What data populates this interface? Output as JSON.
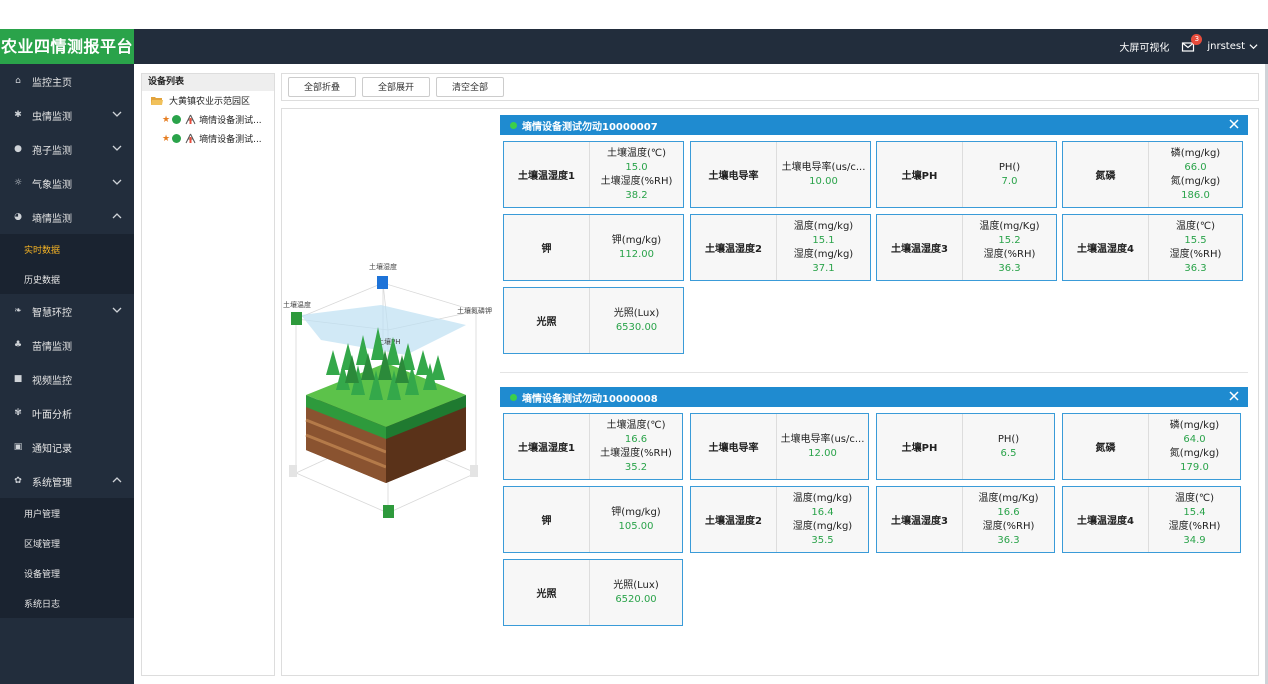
{
  "app": {
    "title": "农业四情测报平台"
  },
  "header": {
    "bigscreen": "大屏可视化",
    "notify_count": "3",
    "user": "jnrstest"
  },
  "sidebar": {
    "items": [
      {
        "label": "监控主页",
        "icon": "home-icon"
      },
      {
        "label": "虫情监测",
        "icon": "bug-icon"
      },
      {
        "label": "孢子监测",
        "icon": "spore-icon"
      },
      {
        "label": "气象监测",
        "icon": "sun-icon"
      },
      {
        "label": "墒情监测",
        "icon": "soil-icon"
      },
      {
        "label": "实时数据"
      },
      {
        "label": "历史数据"
      },
      {
        "label": "智慧环控",
        "icon": "leaf-icon"
      },
      {
        "label": "苗情监测",
        "icon": "seedling-icon"
      },
      {
        "label": "视频监控",
        "icon": "video-icon"
      },
      {
        "label": "叶面分析",
        "icon": "plant-icon"
      },
      {
        "label": "通知记录",
        "icon": "message-icon"
      },
      {
        "label": "系统管理",
        "icon": "gear-icon"
      },
      {
        "label": "用户管理"
      },
      {
        "label": "区域管理"
      },
      {
        "label": "设备管理"
      },
      {
        "label": "系统日志"
      }
    ]
  },
  "tree": {
    "header": "设备列表",
    "root": "大黄镇农业示范园区",
    "devices": [
      "墒情设备测试...",
      "墒情设备测试..."
    ]
  },
  "toolbar": {
    "collapse_all": "全部折叠",
    "expand_all": "全部展开",
    "clear_all": "清空全部"
  },
  "iso_labels": {
    "top": "土壤湿度",
    "left": "土壤温度",
    "right": "土壤氮磷钾",
    "mid": "土壤PH"
  },
  "devices": [
    {
      "title": "墒情设备测试勿动10000007",
      "cards": [
        {
          "name": "土壤温湿度1",
          "lines": [
            {
              "t": "土壤温度(℃)"
            },
            {
              "v": "15.0"
            },
            {
              "t": "土壤湿度(%RH)"
            },
            {
              "v": "38.2"
            }
          ]
        },
        {
          "name": "土壤电导率",
          "lines": [
            {
              "t": "土壤电导率(us/c..."
            },
            {
              "v": "10.00"
            }
          ]
        },
        {
          "name": "土壤PH",
          "lines": [
            {
              "t": "PH()"
            },
            {
              "v": "7.0"
            }
          ]
        },
        {
          "name": "氮磷",
          "lines": [
            {
              "t": "磷(mg/kg)"
            },
            {
              "v": "66.0"
            },
            {
              "t": "氮(mg/kg)"
            },
            {
              "v": "186.0"
            }
          ]
        },
        {
          "name": "钾",
          "lines": [
            {
              "t": "钾(mg/kg)"
            },
            {
              "v": "112.00"
            }
          ]
        },
        {
          "name": "土壤温湿度2",
          "lines": [
            {
              "t": "温度(mg/kg)"
            },
            {
              "v": "15.1"
            },
            {
              "t": "湿度(mg/kg)"
            },
            {
              "v": "37.1"
            }
          ]
        },
        {
          "name": "土壤温湿度3",
          "lines": [
            {
              "t": "温度(mg/Kg)"
            },
            {
              "v": "15.2"
            },
            {
              "t": "湿度(%RH)"
            },
            {
              "v": "36.3"
            }
          ]
        },
        {
          "name": "土壤温湿度4",
          "lines": [
            {
              "t": "温度(℃)"
            },
            {
              "v": "15.5"
            },
            {
              "t": "湿度(%RH)"
            },
            {
              "v": "36.3"
            }
          ]
        },
        {
          "name": "光照",
          "lines": [
            {
              "t": "光照(Lux)"
            },
            {
              "v": "6530.00"
            }
          ]
        }
      ]
    },
    {
      "title": "墒情设备测试勿动10000008",
      "cards": [
        {
          "name": "土壤温湿度1",
          "lines": [
            {
              "t": "土壤温度(℃)"
            },
            {
              "v": "16.6"
            },
            {
              "t": "土壤湿度(%RH)"
            },
            {
              "v": "35.2"
            }
          ]
        },
        {
          "name": "土壤电导率",
          "lines": [
            {
              "t": "土壤电导率(us/c..."
            },
            {
              "v": "12.00"
            }
          ]
        },
        {
          "name": "土壤PH",
          "lines": [
            {
              "t": "PH()"
            },
            {
              "v": "6.5"
            }
          ]
        },
        {
          "name": "氮磷",
          "lines": [
            {
              "t": "磷(mg/kg)"
            },
            {
              "v": "64.0"
            },
            {
              "t": "氮(mg/kg)"
            },
            {
              "v": "179.0"
            }
          ]
        },
        {
          "name": "钾",
          "lines": [
            {
              "t": "钾(mg/kg)"
            },
            {
              "v": "105.00"
            }
          ]
        },
        {
          "name": "土壤温湿度2",
          "lines": [
            {
              "t": "温度(mg/kg)"
            },
            {
              "v": "16.4"
            },
            {
              "t": "湿度(mg/kg)"
            },
            {
              "v": "35.5"
            }
          ]
        },
        {
          "name": "土壤温湿度3",
          "lines": [
            {
              "t": "温度(mg/Kg)"
            },
            {
              "v": "16.6"
            },
            {
              "t": "湿度(%RH)"
            },
            {
              "v": "36.3"
            }
          ]
        },
        {
          "name": "土壤温湿度4",
          "lines": [
            {
              "t": "温度(℃)"
            },
            {
              "v": "15.4"
            },
            {
              "t": "湿度(%RH)"
            },
            {
              "v": "34.9"
            }
          ]
        },
        {
          "name": "光照",
          "lines": [
            {
              "t": "光照(Lux)"
            },
            {
              "v": "6520.00"
            }
          ]
        }
      ]
    }
  ],
  "colors": {
    "sidebar_bg": "#222d3c",
    "brand_green": "#2aa34a",
    "device_bar": "#1f8bd0",
    "active_sub": "#f5b324",
    "value_green": "#2aa34a"
  }
}
